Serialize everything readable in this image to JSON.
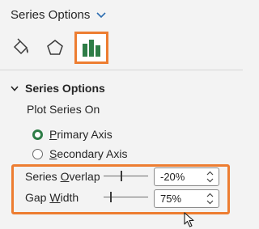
{
  "pane": {
    "title": "Series Options"
  },
  "tabs": [
    {
      "name": "Fill & Line",
      "icon": "paint-bucket-icon"
    },
    {
      "name": "Effects",
      "icon": "pentagon-icon"
    },
    {
      "name": "Series Options",
      "icon": "bar-chart-icon",
      "selected": true
    }
  ],
  "section": {
    "title": "Series Options",
    "expanded": true
  },
  "plot_series_on": {
    "label": "Plot Series On",
    "options": [
      {
        "before": "",
        "accel": "P",
        "after": "rimary Axis",
        "selected": true
      },
      {
        "before": "",
        "accel": "S",
        "after": "econdary Axis",
        "selected": false
      }
    ]
  },
  "series_overlap": {
    "before": "Series ",
    "accel": "O",
    "after": "verlap",
    "value": "-20%",
    "level_percent": -20
  },
  "gap_width": {
    "before": "Gap ",
    "accel": "W",
    "after": "idth",
    "value": "75%",
    "level_percent": 75
  },
  "colors": {
    "accent_highlight": "#ed7d31",
    "tab_icon_green": "#2e7d47",
    "radio_selected": "#2e7d47"
  }
}
